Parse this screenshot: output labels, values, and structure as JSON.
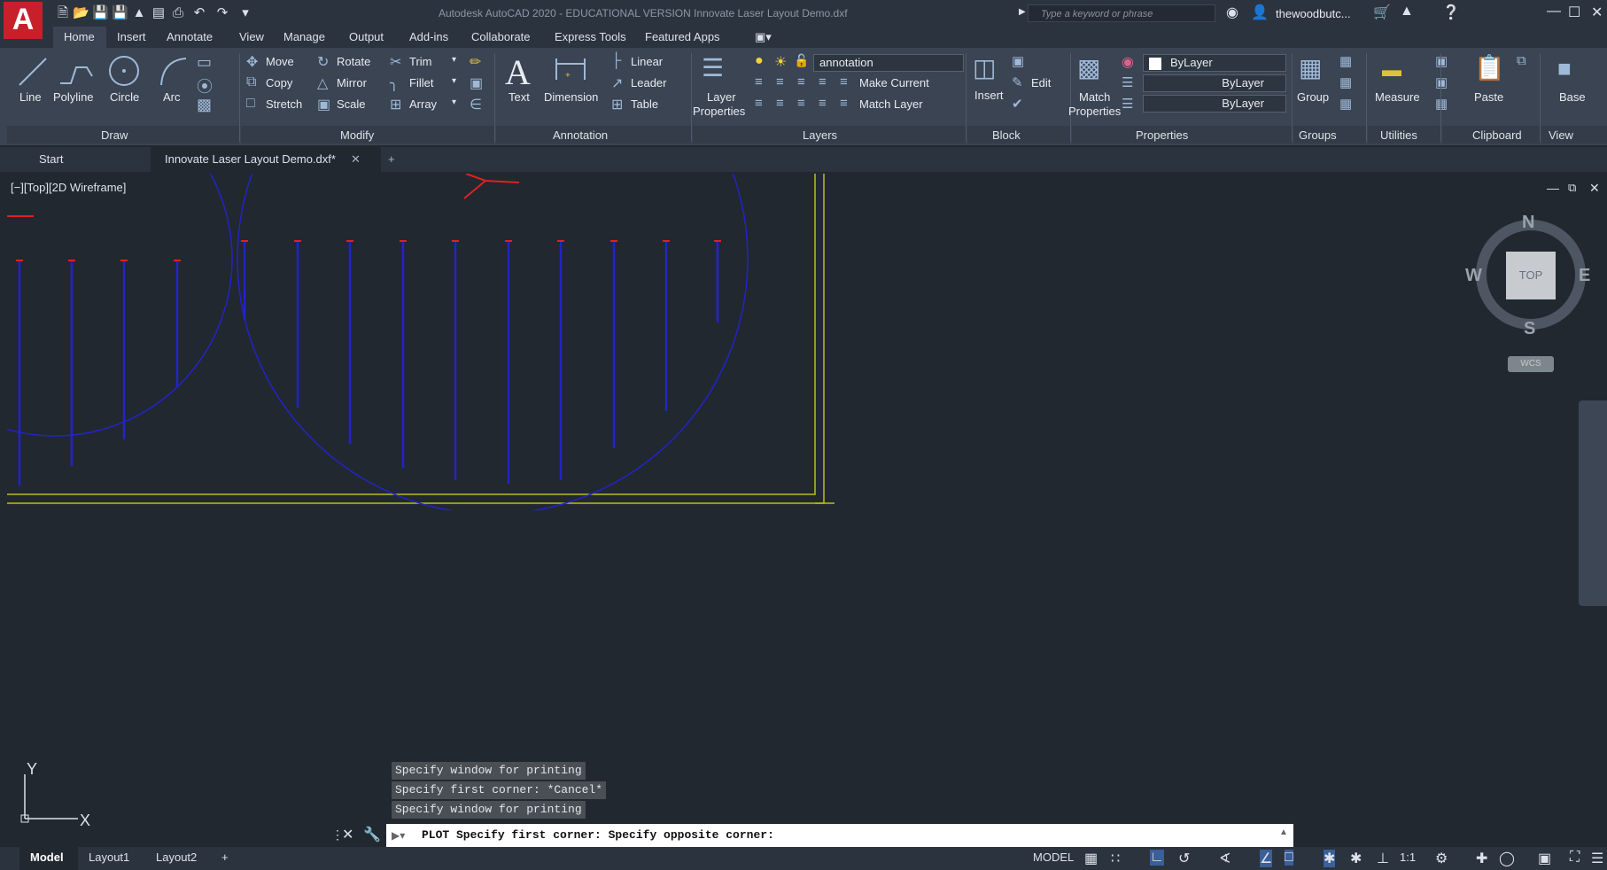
{
  "title_bar": {
    "title": "Autodesk AutoCAD 2020 - EDUCATIONAL VERSION   Innovate Laser Layout Demo.dxf",
    "search_placeholder": "Type a keyword or phrase",
    "user": "thewoodbutc...",
    "logo": "A"
  },
  "ribbon_tabs": [
    "Home",
    "Insert",
    "Annotate",
    "View",
    "Manage",
    "Output",
    "Add-ins",
    "Collaborate",
    "Express Tools",
    "Featured Apps"
  ],
  "draw": {
    "title": "Draw",
    "line": "Line",
    "polyline": "Polyline",
    "circle": "Circle",
    "arc": "Arc"
  },
  "modify": {
    "title": "Modify",
    "move": "Move",
    "rotate": "Rotate",
    "trim": "Trim",
    "copy": "Copy",
    "mirror": "Mirror",
    "fillet": "Fillet",
    "stretch": "Stretch",
    "scale": "Scale",
    "array": "Array"
  },
  "annotation": {
    "title": "Annotation",
    "text": "Text",
    "dimension": "Dimension",
    "linear": "Linear",
    "leader": "Leader",
    "table": "Table"
  },
  "layers": {
    "title": "Layers",
    "layer_properties_1": "Layer",
    "layer_properties_2": "Properties",
    "current_layer": "annotation",
    "make_current": "Make Current",
    "match_layer": "Match Layer"
  },
  "block": {
    "title": "Block",
    "insert": "Insert",
    "edit": "Edit"
  },
  "properties": {
    "title": "Properties",
    "match_1": "Match",
    "match_2": "Properties",
    "color": "ByLayer",
    "linetype": "ByLayer",
    "lineweight": "ByLayer"
  },
  "groups": {
    "title": "Groups",
    "group": "Group"
  },
  "utilities": {
    "title": "Utilities",
    "measure": "Measure"
  },
  "clipboard": {
    "title": "Clipboard",
    "paste": "Paste"
  },
  "view_panel": {
    "title": "View",
    "base": "Base"
  },
  "file_tabs": {
    "start": "Start",
    "document": "Innovate Laser Layout Demo.dxf*",
    "add": "+"
  },
  "viewport": {
    "label": "[−][Top][2D Wireframe]"
  },
  "viewcube": {
    "n": "N",
    "s": "S",
    "e": "E",
    "w": "W",
    "top": "TOP",
    "wcs": "WCS"
  },
  "ucs": {
    "x": "X",
    "y": "Y"
  },
  "command_history": [
    "Specify window for printing",
    "Specify first corner: *Cancel*",
    "Specify window for printing"
  ],
  "command_line": "PLOT Specify first corner: Specify opposite corner:",
  "layout_tabs": [
    "Model",
    "Layout1",
    "Layout2",
    "+"
  ],
  "status": {
    "model": "MODEL",
    "scale": "1:1"
  },
  "colors": {
    "drawing_blue": "#2323c8",
    "border_yellow": "#bdbd1f",
    "marker_red": "#e02020",
    "logo_red": "#c8202a"
  }
}
